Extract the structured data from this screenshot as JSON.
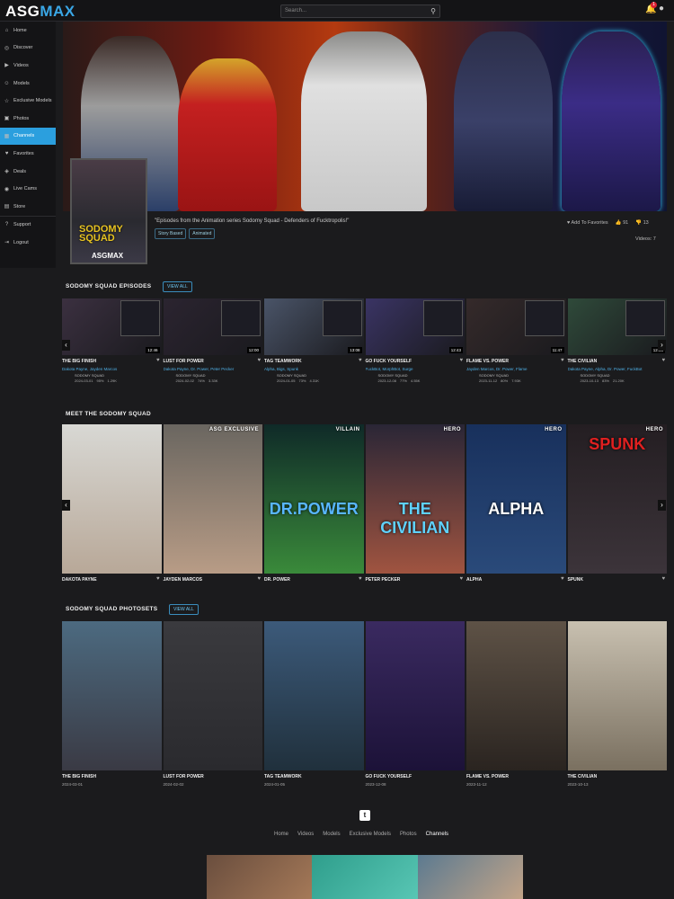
{
  "brand": {
    "logo_pre": "ASG",
    "logo_post": "MAX",
    "accent": "#2b9fde"
  },
  "search": {
    "placeholder": "Search..."
  },
  "header": {
    "notification_count": "1"
  },
  "sidebar": {
    "items": [
      {
        "label": "Home",
        "icon": "home-icon"
      },
      {
        "label": "Discover",
        "icon": "compass-icon"
      },
      {
        "label": "Videos",
        "icon": "video-icon"
      },
      {
        "label": "Models",
        "icon": "users-icon"
      },
      {
        "label": "Exclusive Models",
        "icon": "star-icon"
      },
      {
        "label": "Photos",
        "icon": "photo-icon"
      },
      {
        "label": "Channels",
        "icon": "grid-icon",
        "active": true
      },
      {
        "label": "Favorites",
        "icon": "heart-icon"
      },
      {
        "label": "Deals",
        "icon": "tag-icon"
      },
      {
        "label": "Live Cams",
        "icon": "camera-icon"
      },
      {
        "label": "Store",
        "icon": "store-icon"
      },
      {
        "label": "Support",
        "icon": "help-icon"
      },
      {
        "label": "Logout",
        "icon": "logout-icon"
      }
    ]
  },
  "channel": {
    "cover_title": "SODOMY SQUAD",
    "cover_brand": "ASGMAX",
    "description": "\"Episodes from the Animation series Sodomy Squad - Defenders of Fucktropolis!\"",
    "tags": [
      "Story Based",
      "Animated"
    ],
    "favorites_label": "Add To Favorites",
    "likes": "91",
    "dislikes": "13",
    "videos_count": "Videos: 7"
  },
  "episodes": {
    "title": "SODOMY SQUAD EPISODES",
    "view_all": "VIEW ALL",
    "items": [
      {
        "title": "THE BIG FINISH",
        "models": "Dakota Payne, Jayden Marcos",
        "studio": "SODOMY SQUAD",
        "date": "2024-03-01",
        "rating": "95%",
        "views": "1.29K",
        "duration": "12:46"
      },
      {
        "title": "LUST FOR POWER",
        "models": "Dakota Payne, Dr. Power, Peter Pecker",
        "studio": "SODOMY SQUAD",
        "date": "2024-02-02",
        "rating": "74%",
        "views": "3.33K",
        "duration": "12:00"
      },
      {
        "title": "TAG TEAMWORK",
        "models": "Alpha, Bigs, Spunk",
        "studio": "SODOMY SQUAD",
        "date": "2024-01-05",
        "rating": "73%",
        "views": "4.31K",
        "duration": "13:08"
      },
      {
        "title": "GO FUCK YOURSELF",
        "models": "FuckBot, MorphBot, Surge",
        "studio": "SODOMY SQUAD",
        "date": "2023-12-08",
        "rating": "77%",
        "views": "4.55K",
        "duration": "12:43"
      },
      {
        "title": "FLAME VS. POWER",
        "models": "Jayden Marcos, Dr. Power, Flame",
        "studio": "SODOMY SQUAD",
        "date": "2023-11-12",
        "rating": "80%",
        "views": "7.93K",
        "duration": "11:47"
      },
      {
        "title": "THE CIVILIAN",
        "models": "Dakota Payne, Alpha, Dr. Power, FuckBot",
        "studio": "SODOMY SQUAD",
        "date": "2023-10-13",
        "rating": "83%",
        "views": "21.20K",
        "duration": "12:08"
      }
    ]
  },
  "squad": {
    "title": "MEET THE SODOMY SQUAD",
    "items": [
      {
        "name": "DAKOTA PAYNE",
        "badge": ""
      },
      {
        "name": "JAYDEN MARCOS",
        "badge": "ASG EXCLUSIVE"
      },
      {
        "name": "DR. POWER",
        "badge": "VILLAIN",
        "art": "DR.POWER"
      },
      {
        "name": "PETER PECKER",
        "badge": "HERO",
        "art": "THE CIVILIAN"
      },
      {
        "name": "ALPHA",
        "badge": "HERO",
        "art": "ALPHA"
      },
      {
        "name": "SPUNK",
        "badge": "HERO",
        "art": "SPUNK"
      }
    ]
  },
  "photosets": {
    "title": "SODOMY SQUAD PHOTOSETS",
    "view_all": "VIEW ALL",
    "items": [
      {
        "title": "THE BIG FINISH",
        "date": "2024-03-01"
      },
      {
        "title": "LUST FOR POWER",
        "date": "2024-02-02"
      },
      {
        "title": "TAG TEAMWORK",
        "date": "2024-01-05"
      },
      {
        "title": "GO FUCK YOURSELF",
        "date": "2023-12-08"
      },
      {
        "title": "FLAME VS. POWER",
        "date": "2023-11-12"
      },
      {
        "title": "THE CIVILIAN",
        "date": "2023-10-13"
      }
    ]
  },
  "footer": {
    "links": [
      "Home",
      "Videos",
      "Models",
      "Exclusive Models",
      "Photos",
      "Channels"
    ],
    "current": "Channels"
  }
}
